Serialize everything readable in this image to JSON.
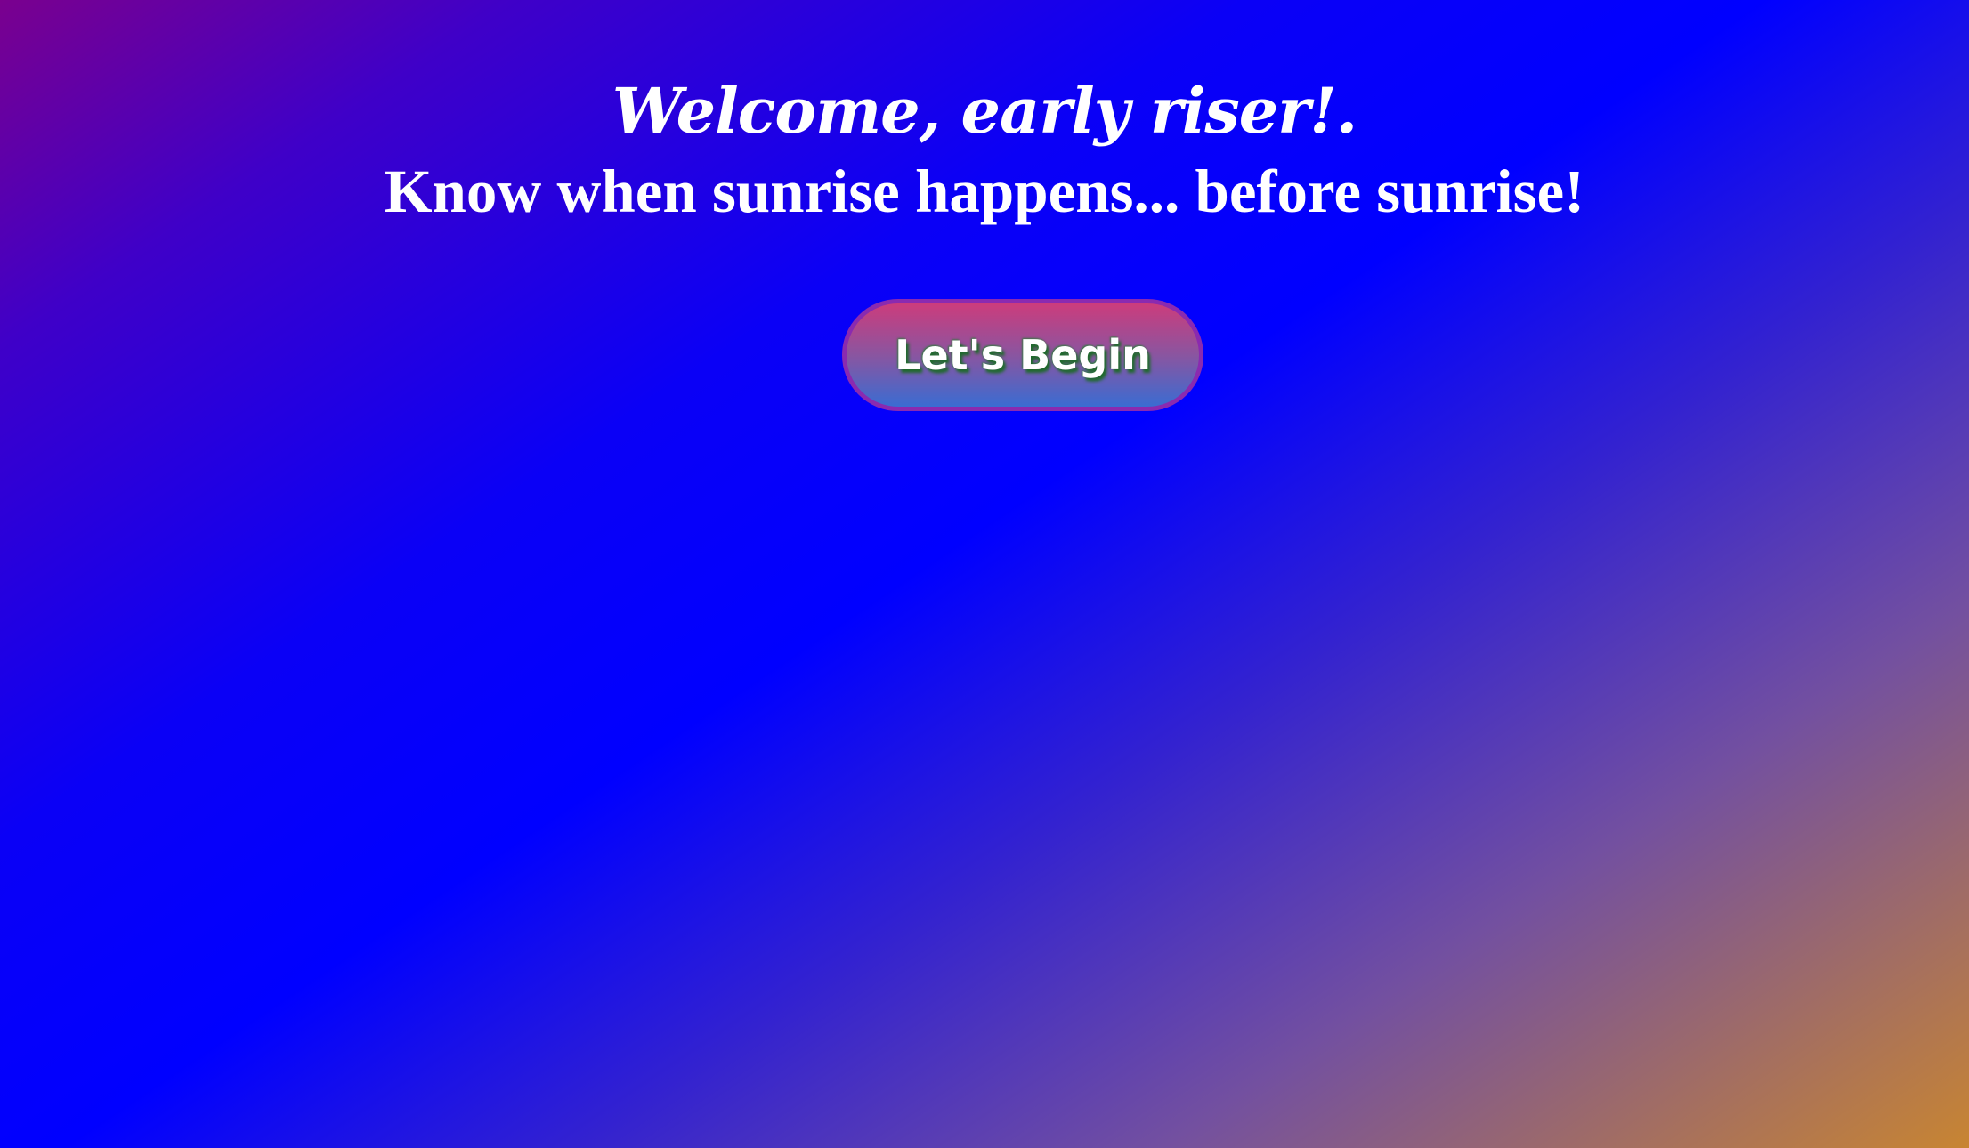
{
  "hero": {
    "welcome": "Welcome, early riser!.",
    "tagline": "Know when sunrise happens... before sunrise!"
  },
  "actions": {
    "begin_label": "Let's Begin"
  },
  "colors": {
    "background_start": "#7a008e",
    "background_mid": "#0000ff",
    "background_end": "#c88532",
    "button_top": "#cc3c7c",
    "button_bottom": "#3a6cd2",
    "button_border": "#8a2ab0",
    "button_text_shadow": "#1f6a2c",
    "text": "#ffffff"
  }
}
